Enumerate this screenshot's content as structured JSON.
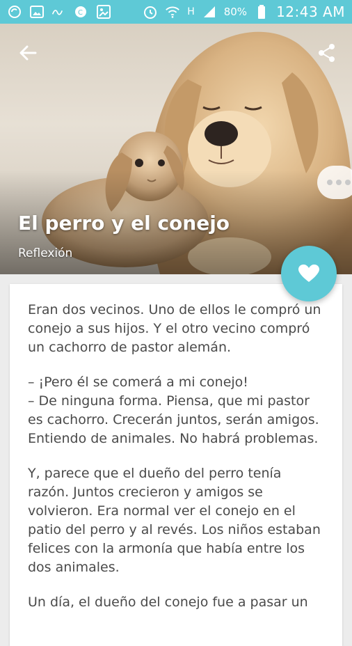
{
  "status_bar": {
    "battery": "80%",
    "time": "12:43 AM",
    "network_label": "H",
    "icons": [
      "sync-icon",
      "image-icon",
      "plex-icon",
      "weather-icon",
      "photos-icon",
      "alarm-icon",
      "wifi-icon",
      "signal-icon",
      "battery-icon"
    ]
  },
  "header": {
    "title": "El perro y el conejo",
    "category": "Reflexión",
    "back_icon": "arrow-left-icon",
    "share_icon": "share-icon",
    "more_icon": "more-dots-icon",
    "favorite_icon": "heart-icon"
  },
  "article": {
    "paragraphs": [
      "Eran dos vecinos. Uno de ellos le compró un conejo a sus hijos. Y el otro vecino compró un cachorro de pastor alemán.",
      "– ¡Pero él se comerá a mi conejo!\n– De ninguna forma. Piensa, que mi pastor es cachorro. Crecerán juntos, serán amigos. Entiendo de animales. No habrá problemas.",
      "Y, parece que el dueño del perro tenía razón. Juntos crecieron y amigos se volvieron. Era normal ver el conejo en el patio del perro y al revés. Los niños estaban felices con la armonía que había entre los dos animales.",
      "Un día, el dueño del conejo fue a pasar un"
    ]
  },
  "colors": {
    "accent": "#5ec9d6",
    "text": "#4a4a4a",
    "background": "#ececec"
  }
}
